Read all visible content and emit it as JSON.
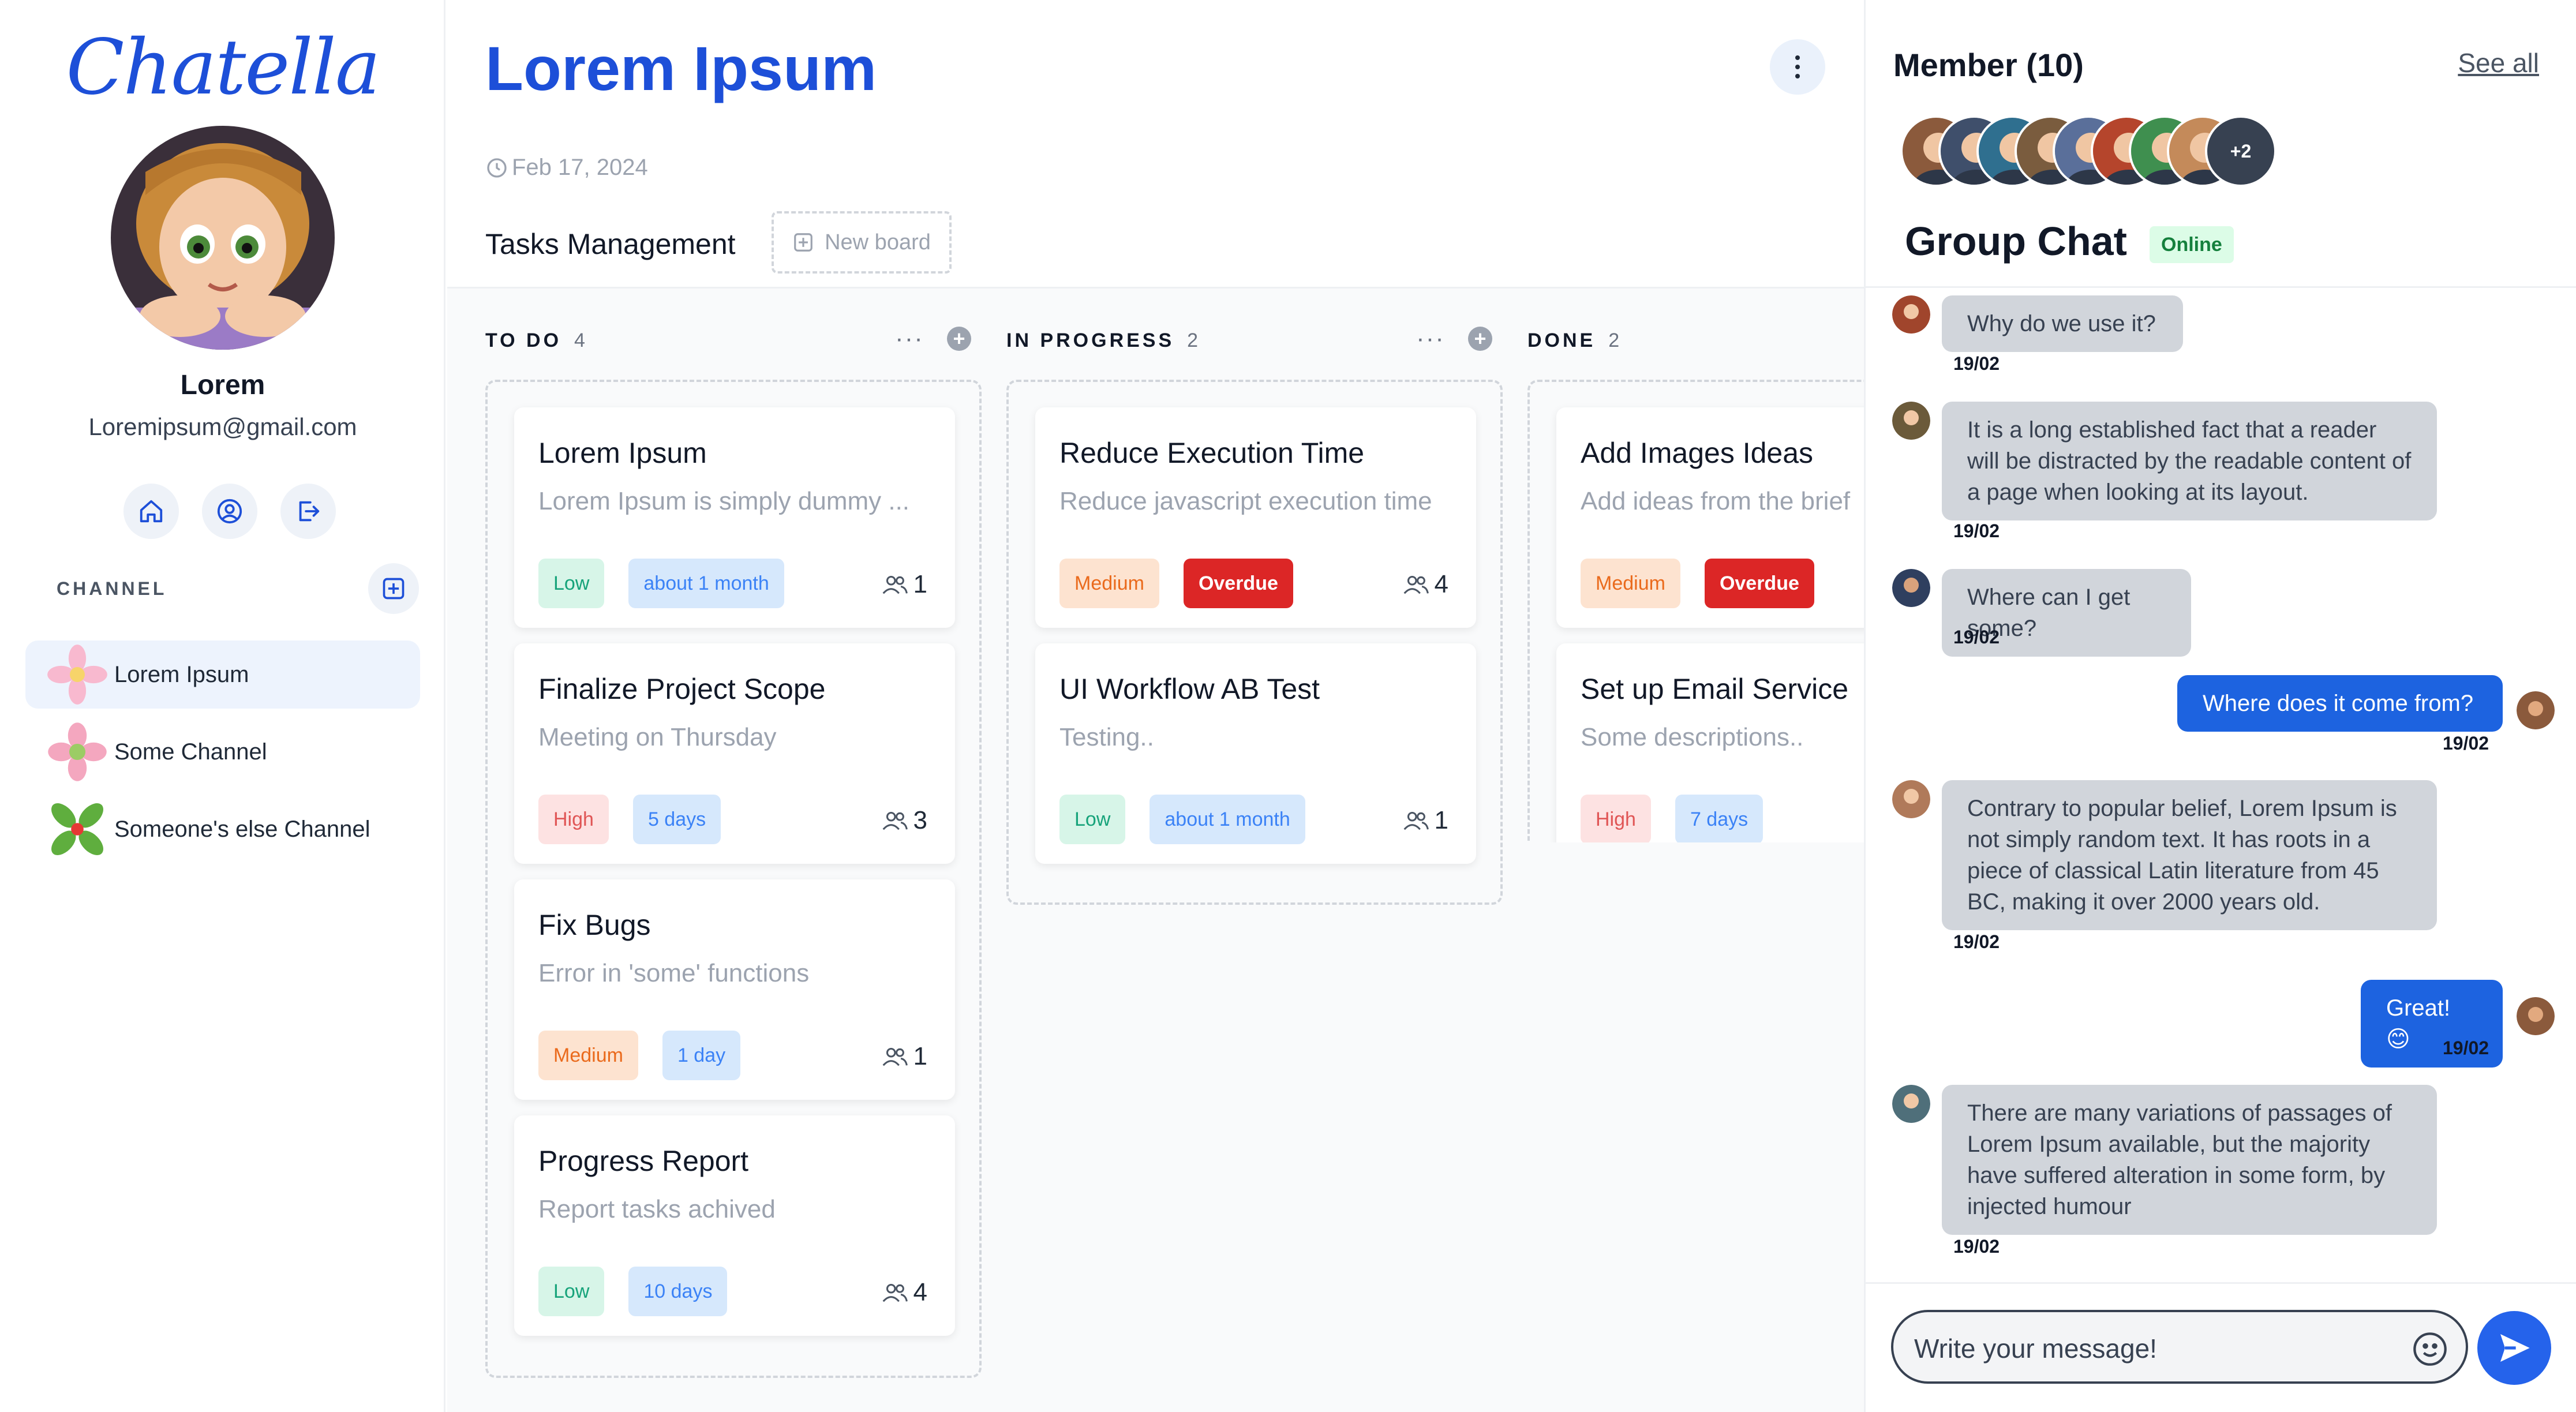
{
  "app": {
    "logo": "Chatella"
  },
  "profile": {
    "name": "Lorem",
    "email": "Loremipsum@gmail.com"
  },
  "quick_icons": [
    "home-icon",
    "user-circle-icon",
    "logout-icon"
  ],
  "channels": {
    "label": "CHANNEL",
    "items": [
      {
        "name": "Lorem Ipsum",
        "active": true,
        "icon": "pink-flower-icon"
      },
      {
        "name": "Some Channel",
        "active": false,
        "icon": "pink-flower-icon"
      },
      {
        "name": "Someone's else Channel",
        "active": false,
        "icon": "green-flower-icon"
      }
    ]
  },
  "main": {
    "title": "Lorem Ipsum",
    "date": "Feb 17, 2024",
    "tasks_label": "Tasks Management",
    "new_board": "New board"
  },
  "board": {
    "columns": [
      {
        "title": "TO DO",
        "count": "4",
        "cards": [
          {
            "title": "Lorem Ipsum",
            "desc": "Lorem Ipsum is simply dummy ...",
            "priority": "Low",
            "priority_class": "low",
            "time": "about 1 month",
            "time_class": "time",
            "members": "1"
          },
          {
            "title": "Finalize Project Scope",
            "desc": "Meeting on Thursday",
            "priority": "High",
            "priority_class": "high",
            "time": "5 days",
            "time_class": "time",
            "members": "3"
          },
          {
            "title": "Fix Bugs",
            "desc": "Error in 'some' functions",
            "priority": "Medium",
            "priority_class": "medium",
            "time": "1 day",
            "time_class": "time",
            "members": "1"
          },
          {
            "title": "Progress Report",
            "desc": "Report tasks achived",
            "priority": "Low",
            "priority_class": "low",
            "time": "10 days",
            "time_class": "time",
            "members": "4"
          }
        ]
      },
      {
        "title": "IN PROGRESS",
        "count": "2",
        "cards": [
          {
            "title": "Reduce Execution Time",
            "desc": "Reduce javascript execution time",
            "priority": "Medium",
            "priority_class": "medium",
            "time": "Overdue",
            "time_class": "overdue",
            "members": "4"
          },
          {
            "title": "UI Workflow AB Test",
            "desc": "Testing..",
            "priority": "Low",
            "priority_class": "low",
            "time": "about 1 month",
            "time_class": "time",
            "members": "1"
          }
        ]
      },
      {
        "title": "DONE",
        "count": "2",
        "cards": [
          {
            "title": "Add Images Ideas",
            "desc": "Add ideas from the brief",
            "priority": "Medium",
            "priority_class": "medium",
            "time": "Overdue",
            "time_class": "overdue",
            "members": ""
          },
          {
            "title": "Set up Email Service",
            "desc": "Some descriptions..",
            "priority": "High",
            "priority_class": "high",
            "time": "7 days",
            "time_class": "time",
            "members": ""
          }
        ]
      }
    ]
  },
  "members": {
    "title": "Member (10)",
    "see_all": "See all",
    "avatar_colors": [
      "#8b5a3c",
      "#3f4f6b",
      "#2f6f8f",
      "#7a5c3e",
      "#5a6f9a",
      "#b5452c",
      "#3f8f4f",
      "#c48a5a"
    ],
    "more": "+2"
  },
  "chat": {
    "title": "Group Chat",
    "status": "Online",
    "messages": [
      {
        "direction": "in",
        "text": "Why do we use it?",
        "time": "19/02",
        "avatar_color": "#a0452c"
      },
      {
        "direction": "in",
        "text": "It is a long established fact that a reader will be distracted by the readable content of a page when looking at its layout.",
        "time": "19/02",
        "avatar_color": "#6b5a3a"
      },
      {
        "direction": "in",
        "text": "Where can I get some?",
        "time": "19/02",
        "avatar_color": "#2f3f5f"
      },
      {
        "direction": "out",
        "text": "Where does it come from?",
        "time": "19/02",
        "avatar_color": "#8b5a3c"
      },
      {
        "direction": "in",
        "text": "Contrary to popular belief, Lorem Ipsum is not simply random text. It has roots in a piece of classical Latin literature from 45 BC, making it over 2000 years old.",
        "time": "19/02",
        "avatar_color": "#b07a5a"
      },
      {
        "direction": "out",
        "text": "Great! 😊",
        "time": "19/02",
        "avatar_color": "#8b5a3c"
      },
      {
        "direction": "in",
        "text": "There are many variations of passages of Lorem Ipsum available, but the majority have suffered alteration in some form, by injected humour",
        "time": "19/02",
        "avatar_color": "#4f6f7a"
      }
    ],
    "composer_placeholder": "Write your message!"
  },
  "colors": {
    "accent": "#1d4fd8",
    "send": "#2563eb",
    "overdue": "#dc2626"
  }
}
